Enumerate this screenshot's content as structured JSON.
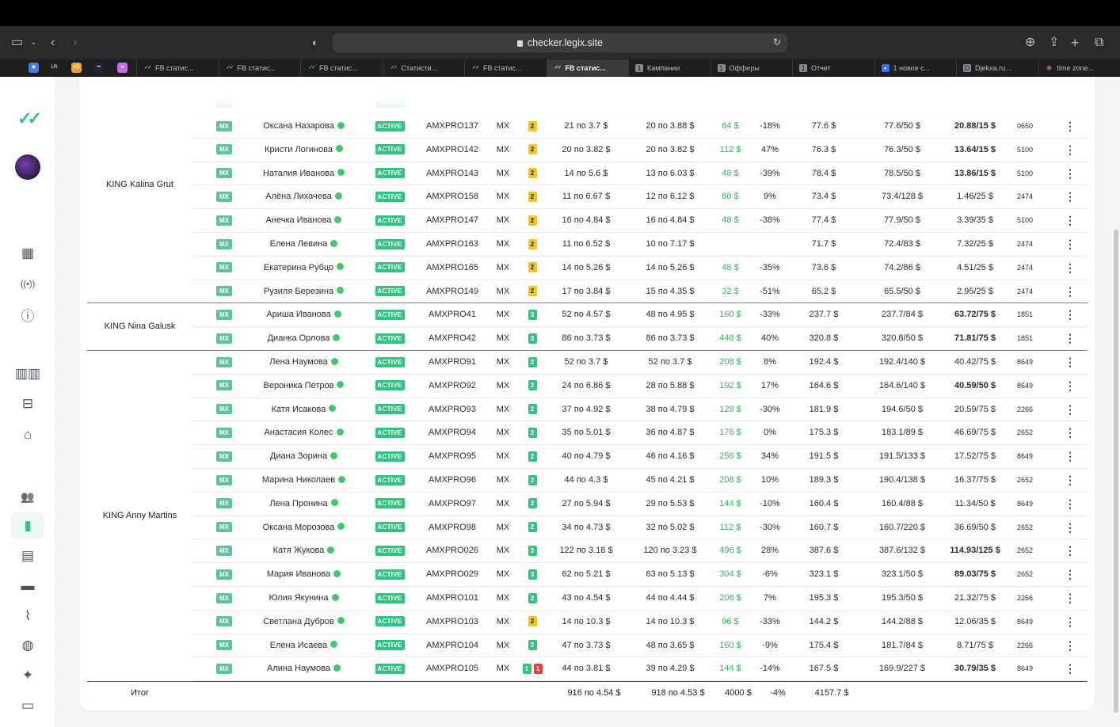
{
  "browser": {
    "url": "checker.legix.site",
    "tabs": [
      {
        "label": "FB статис...",
        "icon": "check-icon"
      },
      {
        "label": "FB статис...",
        "icon": "check-icon"
      },
      {
        "label": "FB статис...",
        "icon": "check-icon"
      },
      {
        "label": "Статисти...",
        "icon": "check-icon"
      },
      {
        "label": "FB статис...",
        "icon": "check-icon"
      },
      {
        "label": "FB статис...",
        "icon": "check-icon",
        "active": true
      },
      {
        "label": "Кампании",
        "icon": "1"
      },
      {
        "label": "Офферы",
        "icon": "1"
      },
      {
        "label": "Отчет",
        "icon": "1"
      },
      {
        "label": "1 новое с...",
        "icon": "chat-icon"
      },
      {
        "label": "Djekxa.ru...",
        "icon": "D"
      },
      {
        "label": "time zone...",
        "icon": "ai-icon"
      }
    ],
    "pinned": [
      {
        "name": "pinned-globe-icon",
        "color": "#4a7bd9",
        "glyph": "◉"
      },
      {
        "name": "pinned-lr-icon",
        "color": "#222222",
        "glyph": "LR"
      },
      {
        "name": "pinned-ad-icon",
        "color": "#e8a33a",
        "glyph": "AD"
      },
      {
        "name": "pinned-dots-icon",
        "color": "#23233a",
        "glyph": "••"
      },
      {
        "name": "pinned-orb-icon",
        "color": "#c16ee0",
        "glyph": "●"
      }
    ]
  },
  "colors": {
    "accent": "#33c27f",
    "profit": "#33b55a",
    "level2": "#f5c518",
    "level3": "#33c27f",
    "badge_red": "#e53e3e"
  },
  "sidebar_icons": [
    "logo-icon",
    "avatar",
    "dashboard-icon",
    "broadcast-icon",
    "info-icon",
    "grid-icon",
    "cash-icon",
    "bank-icon",
    "users-icon",
    "stats-icon",
    "report-icon",
    "card-icon",
    "nodes-icon",
    "globe-icon",
    "sparkle-icon",
    "chat-icon"
  ],
  "groups": [
    {
      "name": "KING Kalina Grut",
      "start": 0,
      "count": 8
    },
    {
      "name": "KING Nina Galusk",
      "start": 8,
      "count": 2
    },
    {
      "name": "KING Anny Martins",
      "start": 10,
      "count": 14
    }
  ],
  "rows": [
    {
      "name": "Оксана Назарова",
      "geo": "MX",
      "status": "ACTIVE",
      "acc": "AMXPRO137",
      "country": "MX",
      "lvl": [
        "2"
      ],
      "spend1": "21 по 3.7 $",
      "spend2": "20 по 3.88 $",
      "profit": "64 $",
      "roi": "-18%",
      "rev": "77.6 $",
      "ratio": "77.6/50 $",
      "cap": "20.88/15 $",
      "capb": true,
      "code": "0650"
    },
    {
      "name": "Кристи Логинова",
      "geo": "MX",
      "status": "ACTIVE",
      "acc": "AMXPRO142",
      "country": "MX",
      "lvl": [
        "2"
      ],
      "spend1": "20 по 3.82 $",
      "spend2": "20 по 3.82 $",
      "profit": "112 $",
      "roi": "47%",
      "rev": "76.3 $",
      "ratio": "76.3/50 $",
      "cap": "13.64/15 $",
      "capb": true,
      "code": "5100"
    },
    {
      "name": "Наталия Иванова",
      "geo": "MX",
      "status": "ACTIVE",
      "acc": "AMXPRO143",
      "country": "MX",
      "lvl": [
        "2"
      ],
      "spend1": "14 по 5.6 $",
      "spend2": "13 по 6.03 $",
      "profit": "48 $",
      "roi": "-39%",
      "rev": "78.4 $",
      "ratio": "78.5/50 $",
      "cap": "13.86/15 $",
      "capb": true,
      "code": "5100"
    },
    {
      "name": "Алёна Лихачева",
      "geo": "MX",
      "status": "ACTIVE",
      "acc": "AMXPRO158",
      "country": "MX",
      "lvl": [
        "2"
      ],
      "spend1": "11 по 6.67 $",
      "spend2": "12 по 6.12 $",
      "profit": "80 $",
      "roi": "9%",
      "rev": "73.4 $",
      "ratio": "73.4/128 $",
      "cap": "1.46/25 $",
      "capb": false,
      "code": "2474"
    },
    {
      "name": "Анечка Иванова",
      "geo": "MX",
      "status": "ACTIVE",
      "acc": "AMXPRO147",
      "country": "MX",
      "lvl": [
        "2"
      ],
      "spend1": "16 по 4.84 $",
      "spend2": "16 по 4.84 $",
      "profit": "48 $",
      "roi": "-38%",
      "rev": "77.4 $",
      "ratio": "77.9/50 $",
      "cap": "3.39/35 $",
      "capb": false,
      "code": "5100"
    },
    {
      "name": "Елена Левина",
      "geo": "MX",
      "status": "ACTIVE",
      "acc": "AMXPRO163",
      "country": "MX",
      "lvl": [
        "2"
      ],
      "spend1": "11 по 6.52 $",
      "spend2": "10 по 7.17 $",
      "profit": "",
      "roi": "",
      "rev": "71.7 $",
      "ratio": "72.4/83 $",
      "cap": "7.32/25 $",
      "capb": false,
      "code": "2474"
    },
    {
      "name": "Екатерина Рубцо",
      "geo": "MX",
      "status": "ACTIVE",
      "acc": "AMXPRO165",
      "country": "MX",
      "lvl": [
        "2"
      ],
      "spend1": "14 по 5.26 $",
      "spend2": "14 по 5.26 $",
      "profit": "48 $",
      "roi": "-35%",
      "rev": "73.6 $",
      "ratio": "74.2/86 $",
      "cap": "4.51/25 $",
      "capb": false,
      "code": "2474"
    },
    {
      "name": "Рузиля Березина",
      "geo": "MX",
      "status": "ACTIVE",
      "acc": "AMXPRO149",
      "country": "MX",
      "lvl": [
        "2"
      ],
      "spend1": "17 по 3.84 $",
      "spend2": "15 по 4.35 $",
      "profit": "32 $",
      "roi": "-51%",
      "rev": "65.2 $",
      "ratio": "65.5/50 $",
      "cap": "2.95/25 $",
      "capb": false,
      "code": "2474"
    },
    {
      "name": "Ариша Иванова",
      "geo": "MX",
      "status": "ACTIVE",
      "acc": "AMXPRO41",
      "country": "MX",
      "lvl": [
        "3"
      ],
      "spend1": "52 по 4.57 $",
      "spend2": "48 по 4.95 $",
      "profit": "160 $",
      "roi": "-33%",
      "rev": "237.7 $",
      "ratio": "237.7/84 $",
      "cap": "63.72/75 $",
      "capb": true,
      "code": "1851"
    },
    {
      "name": "Дианка Орлова",
      "geo": "MX",
      "status": "ACTIVE",
      "acc": "AMXPRO42",
      "country": "MX",
      "lvl": [
        "3"
      ],
      "spend1": "86 по 3.73 $",
      "spend2": "86 по 3.73 $",
      "profit": "448 $",
      "roi": "40%",
      "rev": "320.8 $",
      "ratio": "320.8/50 $",
      "cap": "71.81/75 $",
      "capb": true,
      "code": "1851"
    },
    {
      "name": "Лена Наумова",
      "geo": "MX",
      "status": "ACTIVE",
      "acc": "AMXPRO91",
      "country": "MX",
      "lvl": [
        "2g"
      ],
      "spend1": "52 по 3.7 $",
      "spend2": "52 по 3.7 $",
      "profit": "208 $",
      "roi": "8%",
      "rev": "192.4 $",
      "ratio": "192.4/140 $",
      "cap": "40.42/75 $",
      "capb": false,
      "code": "8649"
    },
    {
      "name": "Вероника Петров",
      "geo": "MX",
      "status": "ACTIVE",
      "acc": "AMXPRO92",
      "country": "MX",
      "lvl": [
        "2g"
      ],
      "spend1": "24 по 6.86 $",
      "spend2": "28 по 5.88 $",
      "profit": "192 $",
      "roi": "17%",
      "rev": "164.6 $",
      "ratio": "164.6/140 $",
      "cap": "40.59/50 $",
      "capb": true,
      "code": "8649"
    },
    {
      "name": "Катя Исакова",
      "geo": "MX",
      "status": "ACTIVE",
      "acc": "AMXPRO93",
      "country": "MX",
      "lvl": [
        "2g"
      ],
      "spend1": "37 по 4.92 $",
      "spend2": "38 по 4.79 $",
      "profit": "128 $",
      "roi": "-30%",
      "rev": "181.9 $",
      "ratio": "194.6/50 $",
      "cap": "20.59/75 $",
      "capb": false,
      "code": "2266"
    },
    {
      "name": "Анастасия Колес",
      "geo": "MX",
      "status": "ACTIVE",
      "acc": "AMXPRO94",
      "country": "MX",
      "lvl": [
        "2g"
      ],
      "spend1": "35 по 5.01 $",
      "spend2": "36 по 4.87 $",
      "profit": "176 $",
      "roi": "0%",
      "rev": "175.3 $",
      "ratio": "183.1/89 $",
      "cap": "46.69/75 $",
      "capb": false,
      "code": "2652"
    },
    {
      "name": "Диана Зорина",
      "geo": "MX",
      "status": "ACTIVE",
      "acc": "AMXPRO95",
      "country": "MX",
      "lvl": [
        "2g"
      ],
      "spend1": "40 по 4.79 $",
      "spend2": "46 по 4.16 $",
      "profit": "256 $",
      "roi": "34%",
      "rev": "191.5 $",
      "ratio": "191.5/133 $",
      "cap": "17.52/75 $",
      "capb": false,
      "code": "8649"
    },
    {
      "name": "Марина Николаев",
      "geo": "MX",
      "status": "ACTIVE",
      "acc": "AMXPRO96",
      "country": "MX",
      "lvl": [
        "2g"
      ],
      "spend1": "44 по 4.3 $",
      "spend2": "45 по 4.21 $",
      "profit": "208 $",
      "roi": "10%",
      "rev": "189.3 $",
      "ratio": "190.4/138 $",
      "cap": "16.37/75 $",
      "capb": false,
      "code": "2652"
    },
    {
      "name": "Лена Пронина",
      "geo": "MX",
      "status": "ACTIVE",
      "acc": "AMXPRO97",
      "country": "MX",
      "lvl": [
        "2g"
      ],
      "spend1": "27 по 5.94 $",
      "spend2": "29 по 5.53 $",
      "profit": "144 $",
      "roi": "-10%",
      "rev": "160.4 $",
      "ratio": "160.4/88 $",
      "cap": "11.34/50 $",
      "capb": false,
      "code": "8649"
    },
    {
      "name": "Оксана Морозова",
      "geo": "MX",
      "status": "ACTIVE",
      "acc": "AMXPRO98",
      "country": "MX",
      "lvl": [
        "2g"
      ],
      "spend1": "34 по 4.73 $",
      "spend2": "32 по 5.02 $",
      "profit": "112 $",
      "roi": "-30%",
      "rev": "160.7 $",
      "ratio": "160.7/220 $",
      "cap": "36.69/50 $",
      "capb": false,
      "code": "2652"
    },
    {
      "name": "Катя Жукова",
      "geo": "MX",
      "status": "ACTIVE",
      "acc": "AMXPRO026",
      "country": "MX",
      "lvl": [
        "3"
      ],
      "spend1": "122 по 3.18 $",
      "spend2": "120 по 3.23 $",
      "profit": "496 $",
      "roi": "28%",
      "rev": "387.6 $",
      "ratio": "387.6/132 $",
      "cap": "114.93/125 $",
      "capb": true,
      "code": "2652"
    },
    {
      "name": "Мария Иванова",
      "geo": "MX",
      "status": "ACTIVE",
      "acc": "AMXPRO029",
      "country": "MX",
      "lvl": [
        "3"
      ],
      "spend1": "62 по 5.21 $",
      "spend2": "63 по 5.13 $",
      "profit": "304 $",
      "roi": "-6%",
      "rev": "323.1 $",
      "ratio": "323.1/50 $",
      "cap": "89.03/75 $",
      "capb": true,
      "code": "2652"
    },
    {
      "name": "Юлия Якунина",
      "geo": "MX",
      "status": "ACTIVE",
      "acc": "AMXPRO101",
      "country": "MX",
      "lvl": [
        "2g"
      ],
      "spend1": "43 по 4.54 $",
      "spend2": "44 по 4.44 $",
      "profit": "208 $",
      "roi": "7%",
      "rev": "195.3 $",
      "ratio": "195.3/50 $",
      "cap": "21.32/75 $",
      "capb": false,
      "code": "2266"
    },
    {
      "name": "Светлана Дубров",
      "geo": "MX",
      "status": "ACTIVE",
      "acc": "AMXPRO103",
      "country": "MX",
      "lvl": [
        "2"
      ],
      "spend1": "14 по 10.3 $",
      "spend2": "14 по 10.3 $",
      "profit": "96 $",
      "roi": "-33%",
      "rev": "144.2 $",
      "ratio": "144.2/88 $",
      "cap": "12.06/35 $",
      "capb": false,
      "code": "8649"
    },
    {
      "name": "Елена Исаева",
      "geo": "MX",
      "status": "ACTIVE",
      "acc": "AMXPRO104",
      "country": "MX",
      "lvl": [
        "2g"
      ],
      "spend1": "47 по 3.73 $",
      "spend2": "48 по 3.65 $",
      "profit": "160 $",
      "roi": "-9%",
      "rev": "175.4 $",
      "ratio": "181.7/84 $",
      "cap": "8.71/75 $",
      "capb": false,
      "code": "2266"
    },
    {
      "name": "Алина Наумова",
      "geo": "MX",
      "status": "ACTIVE",
      "acc": "AMXPRO105",
      "country": "MX",
      "lvl": [
        "1",
        "1r"
      ],
      "spend1": "44 по 3.81 $",
      "spend2": "39 по 4.29 $",
      "profit": "144 $",
      "roi": "-14%",
      "rev": "167.5 $",
      "ratio": "169.9/227 $",
      "cap": "30.79/35 $",
      "capb": true,
      "code": "8649"
    }
  ],
  "footer": {
    "label": "Итог",
    "spend1": "916 по 4.54 $",
    "spend2": "918 по 4.53 $",
    "profit": "4000 $",
    "roi": "-4%",
    "rev": "4157.7 $"
  }
}
